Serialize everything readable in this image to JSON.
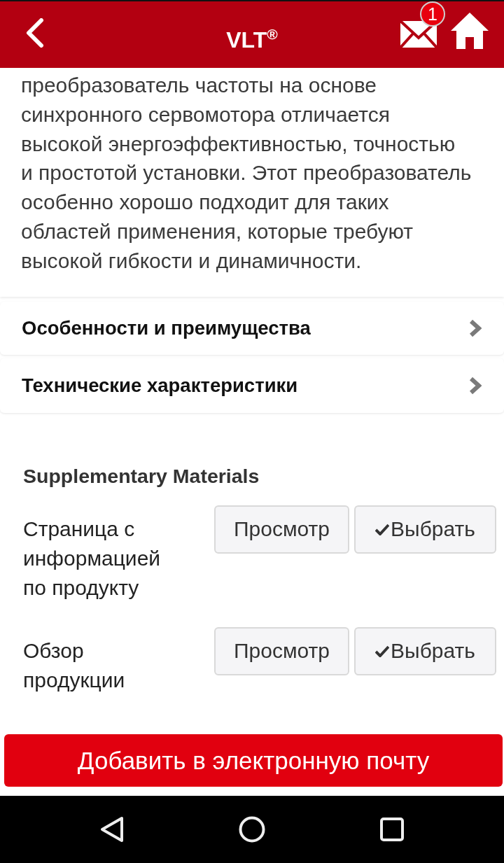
{
  "header": {
    "title": "VLT$^{®}$",
    "mail_badge": "1"
  },
  "description": "преобразователь частоты на основе\nсинхронного сервомотора отличается\nвысокой энергоэффективностью, точностью\nи простотой установки. Этот преобразователь\nособенно хорошо подходит для таких\nобластей применения, которые требуют\nвысокой гибкости и динамичности.",
  "sections": [
    {
      "label": "Особенности и преимущества"
    },
    {
      "label": "Технические характеристики"
    }
  ],
  "supplementary": {
    "title": "Supplementary Materials",
    "items": [
      {
        "label": "Страница с информацией по продукту",
        "view_button": "Просмотр",
        "select_button": "Выбрать"
      },
      {
        "label": "Обзор продукции",
        "view_button": "Просмотр",
        "select_button": "Выбрать"
      }
    ]
  },
  "email_button": "Добавить в электронную почту"
}
